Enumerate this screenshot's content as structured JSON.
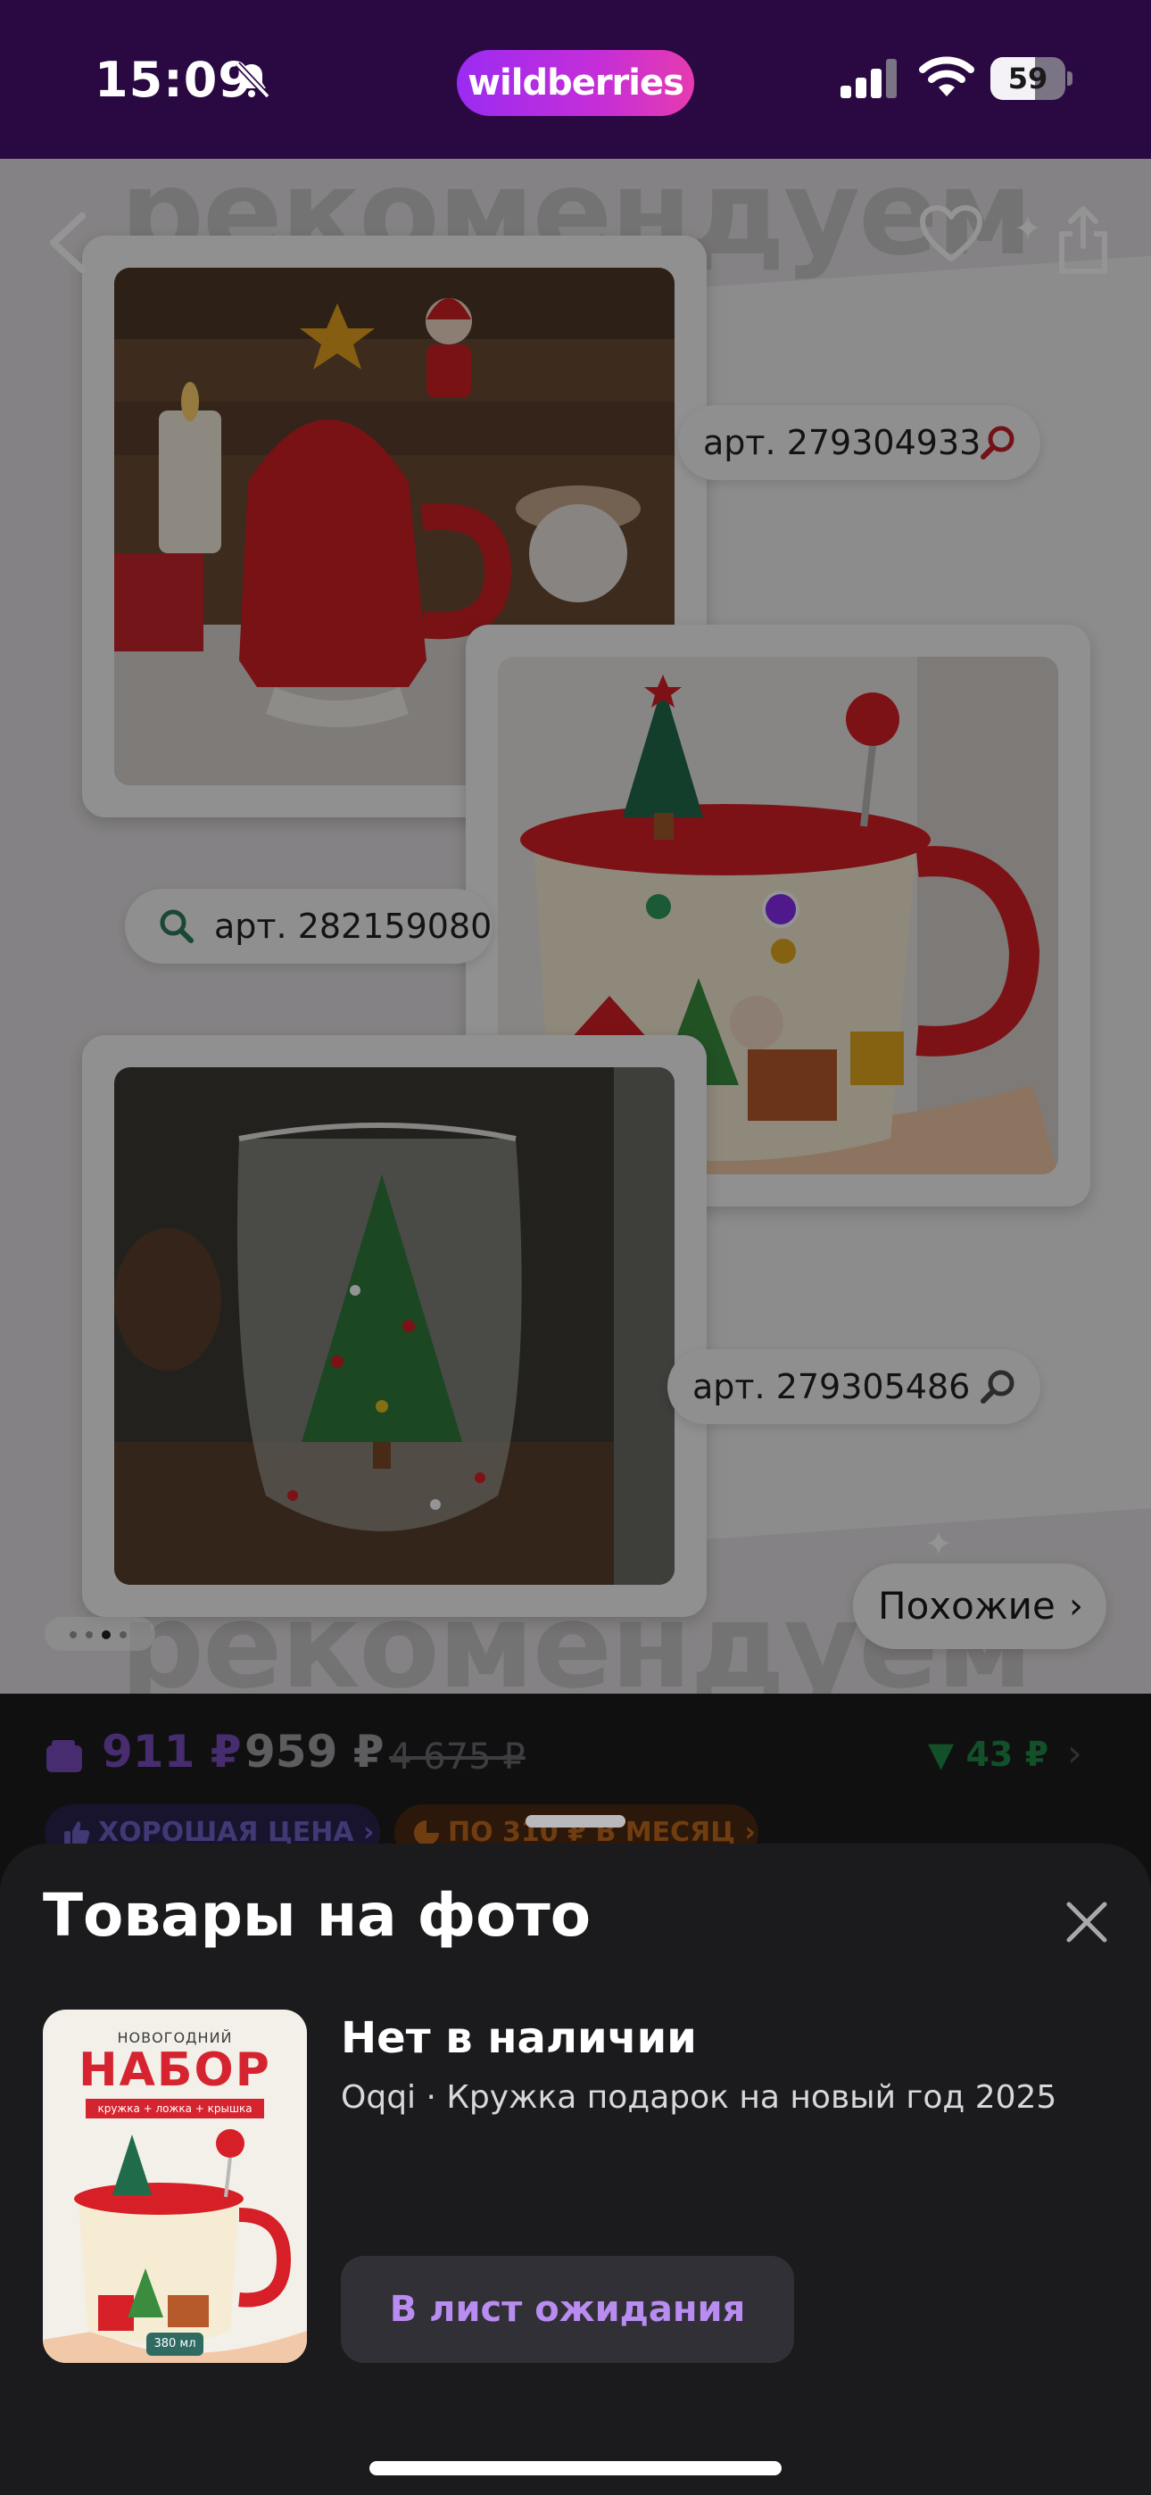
{
  "status_bar": {
    "time": "15:09",
    "brand": "wildberries",
    "battery": "59",
    "battery_level": 0.59,
    "colors": {
      "background": "#2a0942",
      "brand_gradient_start": "#9b2bf2",
      "brand_gradient_end": "#e63bb0"
    },
    "icons": [
      "bell-slash-icon",
      "cellular-signal-icon",
      "wifi-icon",
      "battery-icon"
    ]
  },
  "gallery": {
    "watermark": "рекомендуем",
    "articles": [
      {
        "label": "арт. 279304933",
        "icon": "search-icon"
      },
      {
        "label": "арт. 282159080",
        "icon": "search-icon"
      },
      {
        "label": "арт. 279305486",
        "icon": "search-icon"
      }
    ],
    "similar_button": "Похожие",
    "current_slide": 3,
    "slide_count": 4,
    "icons": [
      "back-arrow-icon",
      "heart-icon",
      "share-icon",
      "chevron-right-icon"
    ]
  },
  "price": {
    "wallet_price": "911 ₽",
    "current_price": "959 ₽",
    "old_price": "4 675 ₽",
    "price_drop": "43 ₽",
    "badges": [
      {
        "label": "ХОРОШАЯ ЦЕНА",
        "icon": "thumbs-up-icon"
      },
      {
        "label": "ПО 310 ₽ В МЕСЯЦ",
        "icon": "installment-icon"
      }
    ],
    "colors": {
      "wallet": "#7a4fc0",
      "drop": "#1e8a48"
    }
  },
  "sheet": {
    "title": "Товары на фото",
    "product": {
      "thumb_small_text": "НОВОГОДНИЙ",
      "thumb_big_text": "НАБОР",
      "thumb_strip_text": "кружка + ложка + крышка",
      "thumb_volume": "380 мл",
      "availability": "Нет в наличии",
      "name": "Oqqi · Кружка подарок на новый год 2025",
      "action": "В лист ожидания"
    },
    "colors": {
      "action_text": "#b88cf0",
      "background": "#1b1b1d"
    },
    "icons": [
      "close-icon"
    ]
  }
}
